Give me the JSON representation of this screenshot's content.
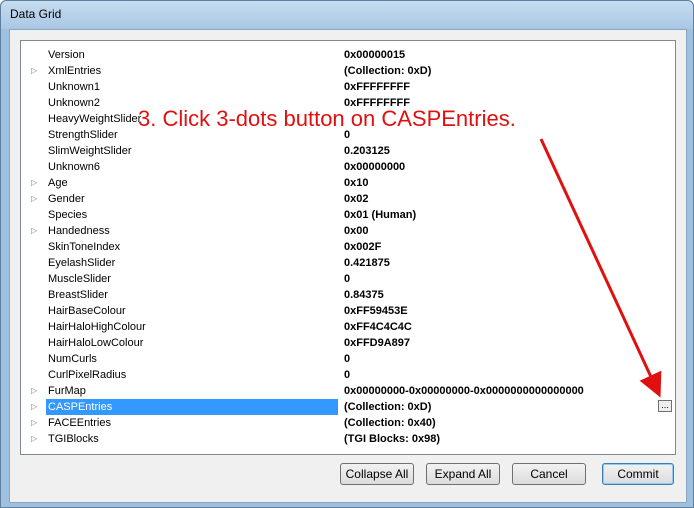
{
  "window": {
    "title": "Data Grid"
  },
  "annotation": {
    "text": "3. Click 3-dots button on CASPEntries.",
    "color": "#e01010"
  },
  "colors": {
    "selection": "#3399ff",
    "annotation": "#e01010",
    "title_bar": "#a9c7e4"
  },
  "rows": [
    {
      "name": "Version",
      "value": "0x00000015",
      "expandable": false
    },
    {
      "name": "XmlEntries",
      "value": "(Collection: 0xD)",
      "expandable": true
    },
    {
      "name": "Unknown1",
      "value": "0xFFFFFFFF",
      "expandable": false
    },
    {
      "name": "Unknown2",
      "value": "0xFFFFFFFF",
      "expandable": false
    },
    {
      "name": "HeavyWeightSlider",
      "value": "",
      "expandable": false
    },
    {
      "name": "StrengthSlider",
      "value": "0",
      "expandable": false
    },
    {
      "name": "SlimWeightSlider",
      "value": "0.203125",
      "expandable": false
    },
    {
      "name": "Unknown6",
      "value": "0x00000000",
      "expandable": false
    },
    {
      "name": "Age",
      "value": "0x10",
      "expandable": true
    },
    {
      "name": "Gender",
      "value": "0x02",
      "expandable": true
    },
    {
      "name": "Species",
      "value": "0x01 (Human)",
      "expandable": false
    },
    {
      "name": "Handedness",
      "value": "0x00",
      "expandable": true
    },
    {
      "name": "SkinToneIndex",
      "value": "0x002F",
      "expandable": false
    },
    {
      "name": "EyelashSlider",
      "value": "0.421875",
      "expandable": false
    },
    {
      "name": "MuscleSlider",
      "value": "0",
      "expandable": false
    },
    {
      "name": "BreastSlider",
      "value": "0.84375",
      "expandable": false
    },
    {
      "name": "HairBaseColour",
      "value": "0xFF59453E",
      "expandable": false
    },
    {
      "name": "HairHaloHighColour",
      "value": "0xFF4C4C4C",
      "expandable": false
    },
    {
      "name": "HairHaloLowColour",
      "value": "0xFFD9A897",
      "expandable": false
    },
    {
      "name": "NumCurls",
      "value": "0",
      "expandable": false
    },
    {
      "name": "CurlPixelRadius",
      "value": "0",
      "expandable": false
    },
    {
      "name": "FurMap",
      "value": "0x00000000-0x00000000-0x0000000000000000",
      "expandable": true
    },
    {
      "name": "CASPEntries",
      "value": "(Collection: 0xD)",
      "expandable": true,
      "selected": true,
      "ellipsis": "..."
    },
    {
      "name": "FACEEntries",
      "value": "(Collection: 0x40)",
      "expandable": true
    },
    {
      "name": "TGIBlocks",
      "value": "(TGI Blocks: 0x98)",
      "expandable": true
    }
  ],
  "buttons": {
    "collapse_all": "Collapse All",
    "expand_all": "Expand All",
    "cancel": "Cancel",
    "commit": "Commit"
  }
}
